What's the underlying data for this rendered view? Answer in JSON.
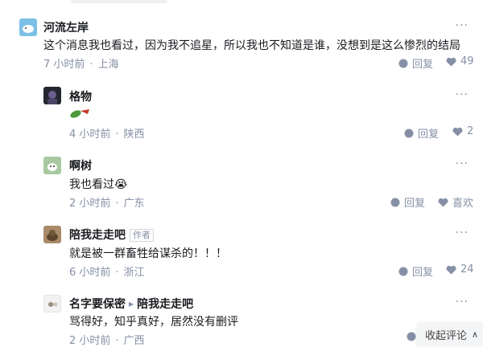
{
  "ui": {
    "more_label": "···",
    "reply_label": "回复",
    "collapse_label": "收起评论",
    "collapse_chevron": "∧",
    "dot": "·"
  },
  "comments": [
    {
      "name": "河流左岸",
      "content": "这个消息我也看过，因为我不追星，所以我也不知道是谁，没想到是这么惨烈的结局",
      "time": "7 小时前",
      "location": "上海",
      "likes": "49"
    },
    {
      "name": "格物",
      "content": "",
      "time": "4 小时前",
      "location": "陕西",
      "likes": "2"
    },
    {
      "name": "啊树",
      "content": "我也看过",
      "content_emoji": "😭",
      "time": "2 小时前",
      "location": "广东",
      "likes": "喜欢"
    },
    {
      "name": "陪我走走吧",
      "author_tag": "作者",
      "content": "就是被一群畜牲给谋杀的！！！",
      "time": "6 小时前",
      "location": "浙江",
      "likes": "24"
    },
    {
      "name": "名字要保密",
      "reply_to": "陪我走走吧",
      "content": "骂得好，知乎真好，居然没有删评",
      "time": "2 小时前",
      "location": "广西"
    }
  ],
  "colors": {
    "text": "#191b1f",
    "meta": "#8590a6"
  },
  "icons": {
    "reply": "comment-bubble-icon",
    "like": "heart-icon",
    "sticker": "green-leaf-flag-sticker"
  }
}
